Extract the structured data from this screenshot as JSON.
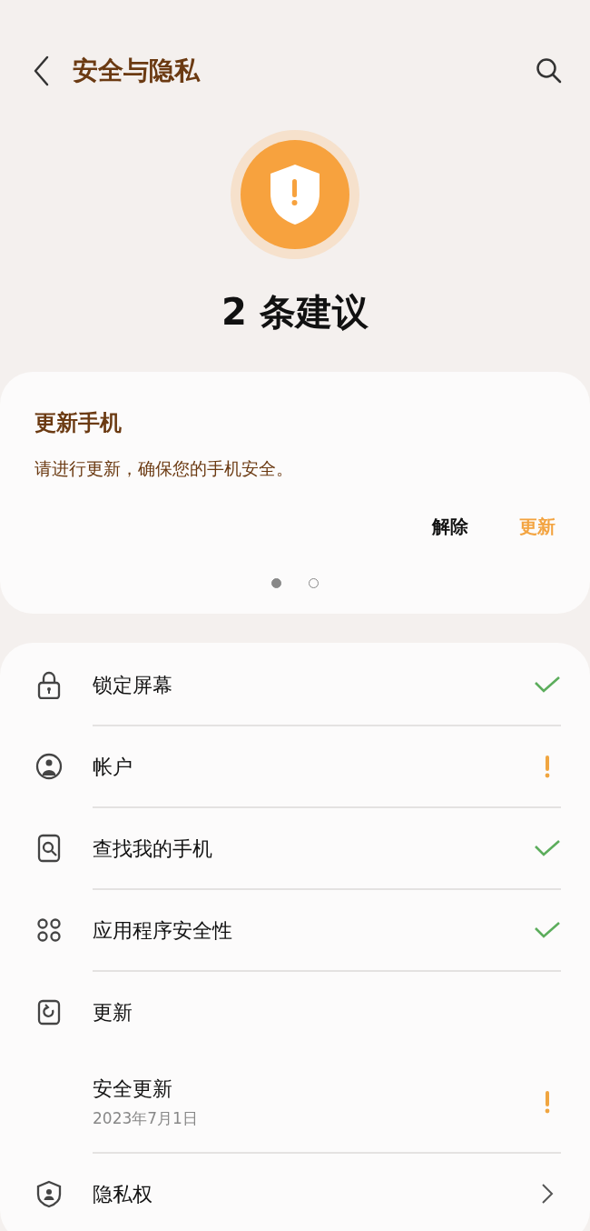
{
  "header": {
    "title": "安全与隐私"
  },
  "status": {
    "summary": "2 条建议"
  },
  "suggestion_card": {
    "title": "更新手机",
    "message": "请进行更新，确保您的手机安全。",
    "actions": [
      {
        "label": "解除",
        "kind": "dismiss"
      },
      {
        "label": "更新",
        "kind": "primary"
      }
    ],
    "pages": [
      {
        "selected": true
      },
      {
        "selected": false
      }
    ]
  },
  "items": [
    {
      "title": "锁定屏幕",
      "kind": "ok",
      "divider": true
    },
    {
      "title": "帐户",
      "kind": "warning",
      "divider": true
    },
    {
      "title": "查找我的手机",
      "kind": "ok",
      "divider": true
    },
    {
      "title": "应用程序安全性",
      "kind": "ok",
      "divider": true
    },
    {
      "title": "更新",
      "kind": "plain",
      "divider": false
    },
    {
      "title": "安全更新",
      "subtitle": "2023年7月1日",
      "kind": "warning",
      "divider": true
    },
    {
      "title": "隐私权",
      "kind": "link",
      "divider": false
    }
  ]
}
